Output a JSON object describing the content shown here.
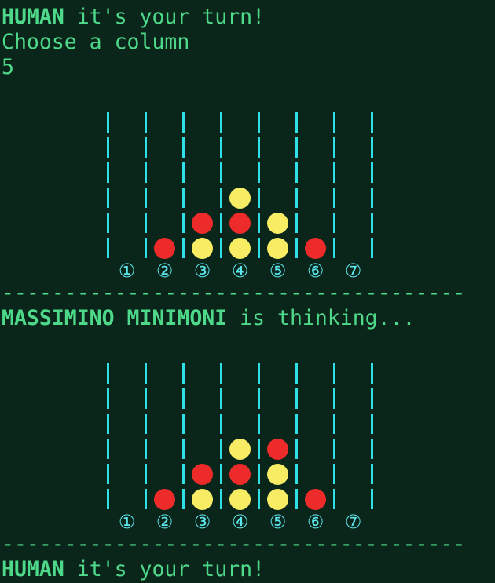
{
  "turn_prompt": {
    "player": "HUMAN",
    "suffix": " it's your turn!"
  },
  "choose_prompt": "Choose a column",
  "user_input": "5",
  "separator": "-------------------------------------",
  "thinking": {
    "player": "MASSIMINO MINIMONI",
    "suffix": " is thinking..."
  },
  "turn_prompt_2": {
    "player": "HUMAN",
    "suffix": " it's your turn!"
  },
  "column_labels": [
    "①",
    "②",
    "③",
    "④",
    "⑤",
    "⑥",
    "⑦"
  ],
  "colors": {
    "background": "#0a261a",
    "text": "#4ed98a",
    "board_lines": "#2ee0e8",
    "red_disc": "#ee2b2b",
    "yellow_disc": "#f7ec64"
  },
  "boards": [
    {
      "rows": [
        [
          ".",
          ".",
          ".",
          ".",
          ".",
          ".",
          "."
        ],
        [
          ".",
          ".",
          ".",
          ".",
          ".",
          ".",
          "."
        ],
        [
          ".",
          ".",
          ".",
          ".",
          ".",
          ".",
          "."
        ],
        [
          ".",
          ".",
          ".",
          "Y",
          ".",
          ".",
          "."
        ],
        [
          ".",
          ".",
          "R",
          "R",
          "Y",
          ".",
          "."
        ],
        [
          ".",
          "R",
          "Y",
          "Y",
          "Y",
          "R",
          "."
        ]
      ]
    },
    {
      "rows": [
        [
          ".",
          ".",
          ".",
          ".",
          ".",
          ".",
          "."
        ],
        [
          ".",
          ".",
          ".",
          ".",
          ".",
          ".",
          "."
        ],
        [
          ".",
          ".",
          ".",
          ".",
          ".",
          ".",
          "."
        ],
        [
          ".",
          ".",
          ".",
          "Y",
          "R",
          ".",
          "."
        ],
        [
          ".",
          ".",
          "R",
          "R",
          "Y",
          ".",
          "."
        ],
        [
          ".",
          "R",
          "Y",
          "Y",
          "Y",
          "R",
          "."
        ]
      ]
    }
  ]
}
